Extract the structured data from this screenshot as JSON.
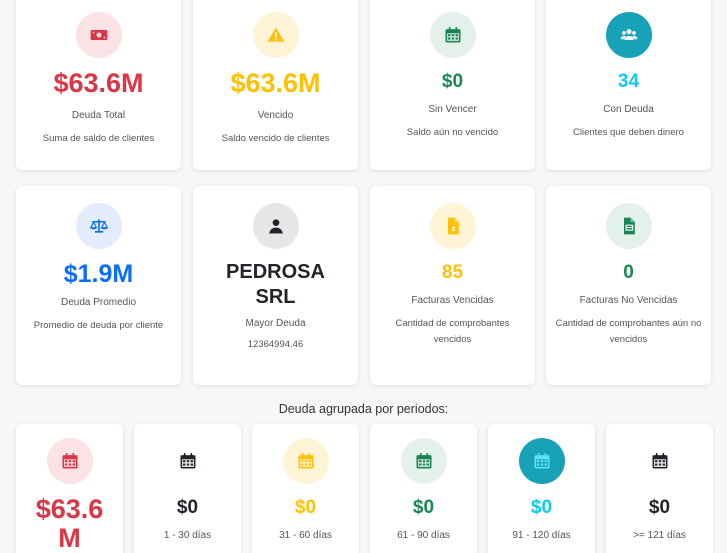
{
  "cards_row1": [
    {
      "value": "$63.6M",
      "label": "Deuda Total",
      "desc": "Suma de saldo de clientes",
      "icon": "money-bill-icon"
    },
    {
      "value": "$63.6M",
      "label": "Vencido",
      "desc": "Saldo vencido de clientes",
      "icon": "warning-icon"
    },
    {
      "value": "$0",
      "label": "Sin Vencer",
      "desc": "Saldo aún no vencido",
      "icon": "calendar-icon"
    },
    {
      "value": "34",
      "label": "Con Deuda",
      "desc": "Clientes que deben dinero",
      "icon": "users-icon"
    }
  ],
  "cards_row2": [
    {
      "value": "$1.9M",
      "label": "Deuda Promedio",
      "desc": "Promedio de deuda por cliente",
      "icon": "scale-icon"
    },
    {
      "value_line1": "PEDROSA",
      "value_line2": "SRL",
      "label": "Mayor Deuda",
      "desc": "12364994.46",
      "icon": "user-icon"
    },
    {
      "value": "85",
      "label": "Facturas Vencidas",
      "desc_line1": "Cantidad de comprobantes",
      "desc_line2": "vencidos",
      "icon": "invoice-dollar-icon"
    },
    {
      "value": "0",
      "label": "Facturas No Vencidas",
      "desc_line1": "Cantidad de comprobantes aún no",
      "desc_line2": "vencidos",
      "icon": "invoice-icon"
    }
  ],
  "periods_title": "Deuda agrupada por periodos:",
  "periods": [
    {
      "value_line1": "$63.6",
      "value_line2": "M",
      "label": "",
      "icon": "calendar-icon"
    },
    {
      "value": "$0",
      "label": "1 - 30 días",
      "icon": "calendar-icon"
    },
    {
      "value": "$0",
      "label": "31 - 60 días",
      "icon": "calendar-icon"
    },
    {
      "value": "$0",
      "label": "61 - 90 días",
      "icon": "calendar-icon"
    },
    {
      "value": "$0",
      "label": "91 - 120 días",
      "icon": "calendar-icon"
    },
    {
      "value": "$0",
      "label": ">= 121 días",
      "icon": "calendar-icon"
    }
  ],
  "colors": {
    "red": "#dc3545",
    "yellow": "#ffc107",
    "green": "#198754",
    "cyan": "#0dcaf0",
    "blue": "#0d6efd",
    "dark": "#212529"
  }
}
